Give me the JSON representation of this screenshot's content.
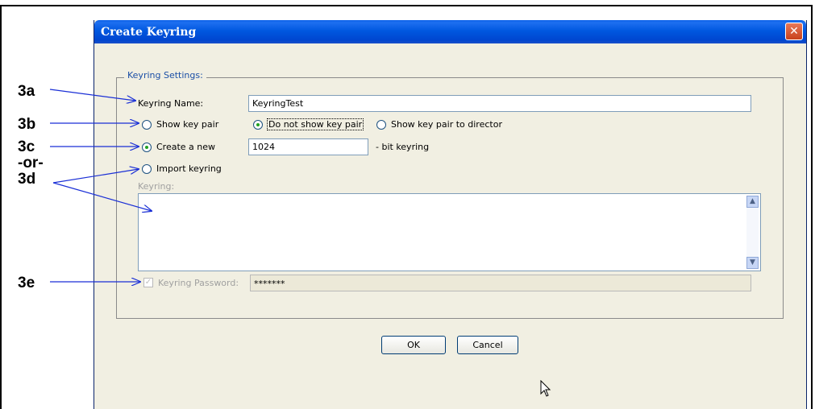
{
  "dialog": {
    "title": "Create Keyring",
    "close_label": "✕"
  },
  "callouts": {
    "a": "3a",
    "b": "3b",
    "c": "3c",
    "or": "-or-",
    "d": "3d",
    "e": "3e"
  },
  "group": {
    "legend": "Keyring Settings:"
  },
  "keyring_name": {
    "label": "Keyring Name:",
    "value": "KeyringTest"
  },
  "key_pair_options": {
    "show": "Show key pair",
    "do_not_show": "Do not show key pair",
    "show_director": "Show key pair to director",
    "selected": "do_not_show"
  },
  "create_new": {
    "label": "Create a new",
    "bits": "1024",
    "suffix": "- bit keyring",
    "selected": true
  },
  "import_keyring": {
    "label": "Import keyring",
    "selected": false
  },
  "keyring_text": {
    "label": "Keyring:",
    "value": ""
  },
  "keyring_password": {
    "label": "Keyring Password:",
    "value": "*******",
    "checked": true
  },
  "buttons": {
    "ok": "OK",
    "cancel": "Cancel"
  },
  "colors": {
    "titlebar": "#0058e0",
    "dialog_bg": "#f1efe2",
    "legend": "#1b4fa6",
    "callout_arrow": "#1a2fd6"
  }
}
